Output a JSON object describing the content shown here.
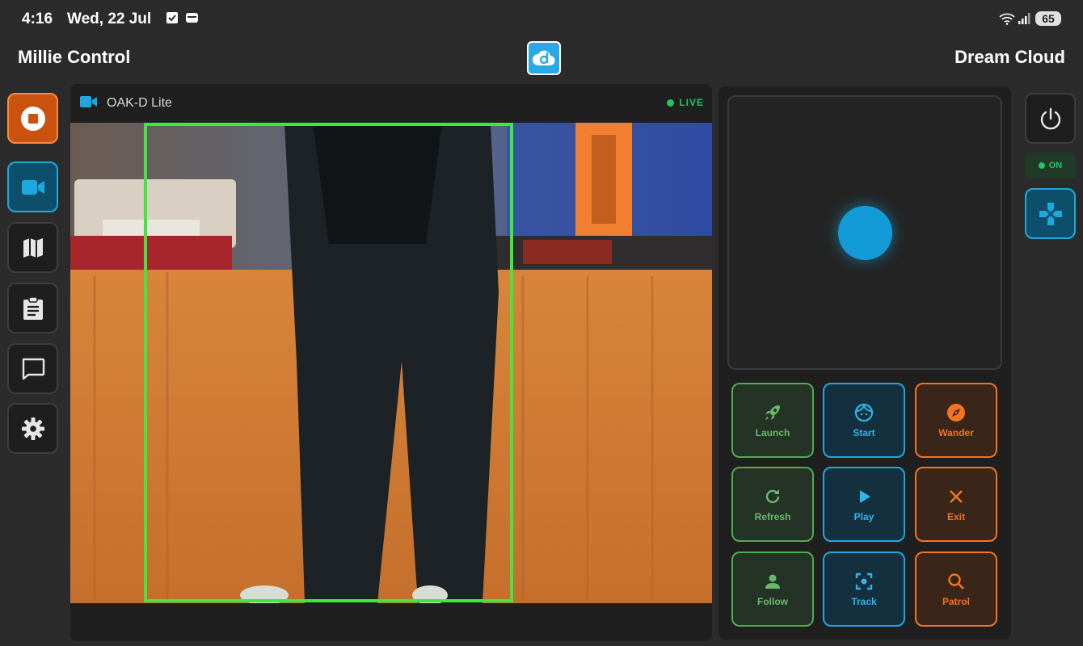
{
  "status_bar": {
    "time": "4:16",
    "date": "Wed, 22 Jul",
    "battery": "65",
    "icons": [
      "checkbox-icon",
      "wallet-icon",
      "wifi-icon",
      "signal-icon"
    ]
  },
  "header": {
    "app_title": "Millie Control",
    "cloud_title": "Dream Cloud",
    "logo": "dream-cloud-logo"
  },
  "left_sidebar": {
    "items": [
      {
        "name": "stop",
        "icon": "stop-icon",
        "accent": "#c9530e"
      },
      {
        "name": "camera",
        "icon": "videocam-icon",
        "active": true
      },
      {
        "name": "map",
        "icon": "map-icon"
      },
      {
        "name": "tasks",
        "icon": "clipboard-icon"
      },
      {
        "name": "chat",
        "icon": "chat-icon"
      },
      {
        "name": "settings",
        "icon": "gear-icon"
      }
    ]
  },
  "camera": {
    "title": "OAK-D Lite",
    "live_label": "LIVE",
    "live_color": "#22c55e",
    "detection_box_color": "#3ee83e"
  },
  "controls": {
    "buttons": [
      {
        "label": "Launch",
        "icon": "rocket-icon",
        "color": "green"
      },
      {
        "label": "Start",
        "icon": "face-icon",
        "color": "blue"
      },
      {
        "label": "Wander",
        "icon": "compass-icon",
        "color": "orange"
      },
      {
        "label": "Refresh",
        "icon": "refresh-icon",
        "color": "green"
      },
      {
        "label": "Play",
        "icon": "play-icon",
        "color": "blue"
      },
      {
        "label": "Exit",
        "icon": "close-icon",
        "color": "orange"
      },
      {
        "label": "Follow",
        "icon": "person-icon",
        "color": "green"
      },
      {
        "label": "Track",
        "icon": "center-focus-icon",
        "color": "blue"
      },
      {
        "label": "Patrol",
        "icon": "search-icon",
        "color": "orange"
      }
    ]
  },
  "right_sidebar": {
    "power_icon": "power-icon",
    "status_label": "ON",
    "gamepad_icon": "gamepad-icon"
  },
  "colors": {
    "green": "#4caf50",
    "blue": "#1ea8e0",
    "orange": "#f5731f",
    "background": "#2b2b2b"
  }
}
